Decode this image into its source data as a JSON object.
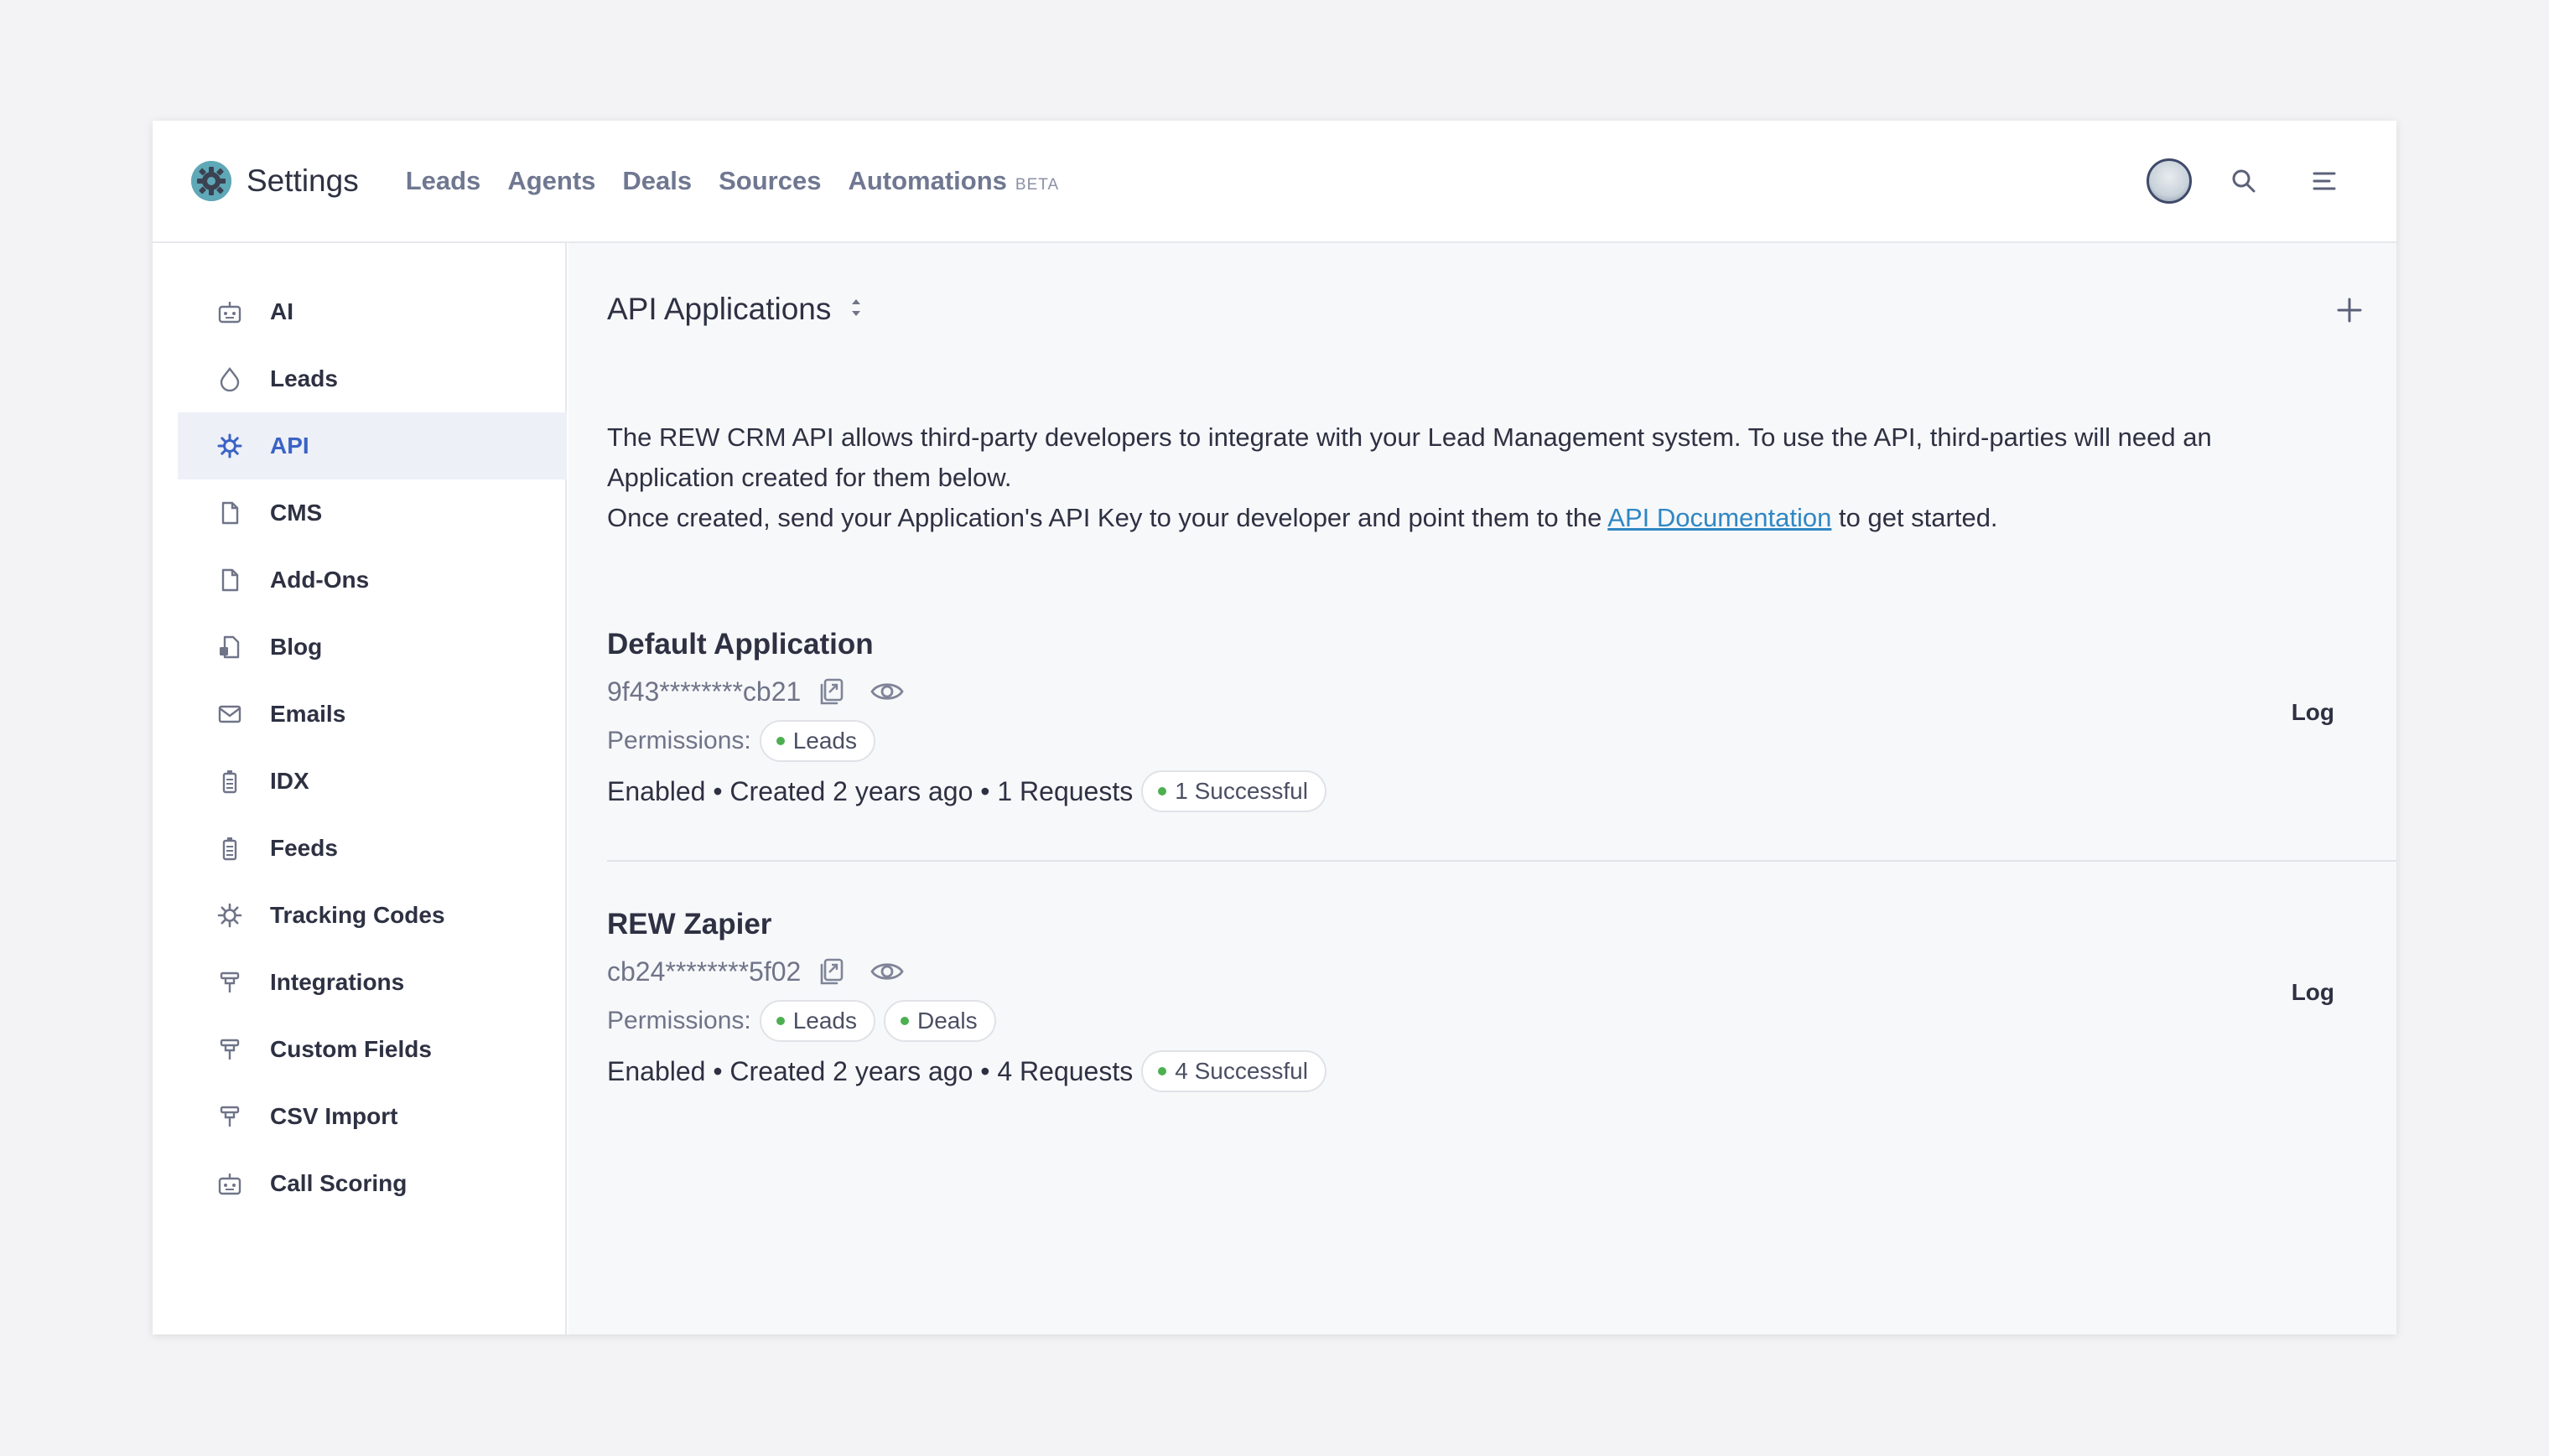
{
  "header": {
    "title": "Settings",
    "nav": [
      {
        "label": "Leads",
        "badge": ""
      },
      {
        "label": "Agents",
        "badge": ""
      },
      {
        "label": "Deals",
        "badge": ""
      },
      {
        "label": "Sources",
        "badge": ""
      },
      {
        "label": "Automations",
        "badge": "BETA"
      }
    ],
    "icons": [
      "settings-logo-icon",
      "avatar",
      "search-icon",
      "menu-icon"
    ]
  },
  "sidebar": {
    "active": "API",
    "items": [
      {
        "label": "AI",
        "icon": "robot-icon"
      },
      {
        "label": "Leads",
        "icon": "leads-icon"
      },
      {
        "label": "API",
        "icon": "gear-icon"
      },
      {
        "label": "CMS",
        "icon": "file-icon"
      },
      {
        "label": "Add-Ons",
        "icon": "file-icon"
      },
      {
        "label": "Blog",
        "icon": "blog-icon"
      },
      {
        "label": "Emails",
        "icon": "mail-icon"
      },
      {
        "label": "IDX",
        "icon": "battery-icon"
      },
      {
        "label": "Feeds",
        "icon": "battery-icon"
      },
      {
        "label": "Tracking Codes",
        "icon": "gear-icon"
      },
      {
        "label": "Integrations",
        "icon": "plug-icon"
      },
      {
        "label": "Custom Fields",
        "icon": "plug-icon"
      },
      {
        "label": "CSV Import",
        "icon": "plug-icon"
      },
      {
        "label": "Call Scoring",
        "icon": "robot-icon"
      }
    ]
  },
  "main": {
    "title": "API Applications",
    "intro_line1": "The REW CRM API allows third-party developers to integrate with your Lead Management system. To use the API, third-parties will need an Application created for them below.",
    "intro_line2_before": "Once created, send your Application's API Key to your developer and point them to the ",
    "intro_link": "API Documentation",
    "intro_line2_after": " to get started.",
    "permissions_label": "Permissions:",
    "log_label": "Log",
    "applications": [
      {
        "name": "Default Application",
        "key": "9f43********cb21",
        "permissions": [
          "Leads"
        ],
        "stats": "Enabled • Created 2 years ago • 1 Requests",
        "success": "1 Successful"
      },
      {
        "name": "REW Zapier",
        "key": "cb24********5f02",
        "permissions": [
          "Leads",
          "Deals"
        ],
        "stats": "Enabled • Created 2 years ago • 4 Requests",
        "success": "4 Successful"
      }
    ]
  },
  "colors": {
    "accent": "#3b63c4",
    "active_bg": "#eef0f8",
    "link": "#2f87c4",
    "success_dot": "#4caf50"
  }
}
